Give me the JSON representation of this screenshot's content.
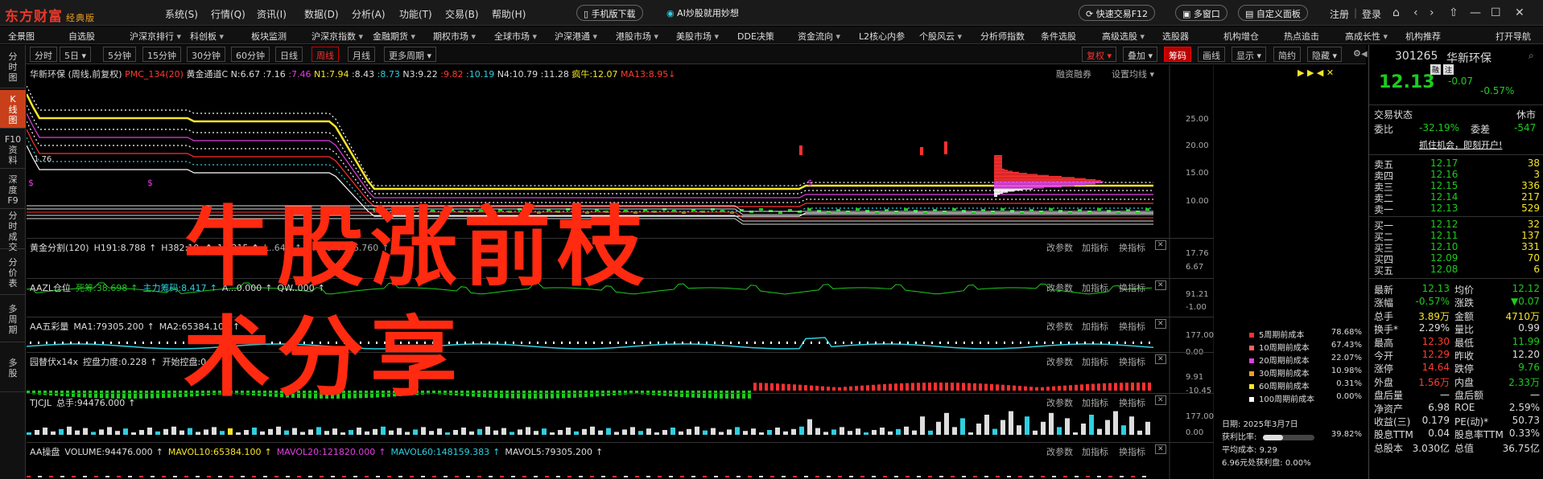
{
  "app": {
    "logo": "东方财富",
    "logo_tag": "经典版"
  },
  "menu": [
    "系统(S)",
    "行情(Q)",
    "资讯(I)",
    "数据(D)",
    "分析(A)",
    "功能(T)",
    "交易(B)",
    "帮助(H)"
  ],
  "top_pills": {
    "mobile": "手机版下载",
    "ai": "AI炒股就用妙想",
    "fast_trade": "快速交易F12",
    "multi": "多窗口",
    "custom": "自定义面板"
  },
  "auth": {
    "register": "注册",
    "login": "登录"
  },
  "tabbar": [
    "全景图",
    "自选股",
    "沪深京排行",
    "科创板",
    "板块监测",
    "沪深京指数",
    "金融期货",
    "期权市场",
    "全球市场",
    "沪深港通",
    "港股市场",
    "美股市场",
    "DDE决策",
    "资金流向",
    "L2核心内参",
    "个股风云",
    "分析师指数",
    "条件选股",
    "高级选股",
    "选股器",
    "机构增仓",
    "热点追击",
    "高成长性",
    "机构推荐",
    "打开导航"
  ],
  "periods": [
    "分时",
    "5日",
    "5分钟",
    "15分钟",
    "30分钟",
    "60分钟",
    "日线",
    "周线",
    "月线",
    "更多周期"
  ],
  "periodbar_right": [
    "复权",
    "叠加",
    "筹码",
    "画线",
    "显示",
    "简约",
    "隐藏"
  ],
  "left_tabs": [
    "分时图",
    "K线图",
    "F10资料",
    "深度F9",
    "分时成交",
    "分价表",
    "多周期",
    "多股"
  ],
  "main_info": {
    "name": "华新环保",
    "mode": "(周线,前复权)",
    "ind": "PMC_134(20)",
    "gold": "黄金通道C",
    "n1": "N:6.67",
    "n2": ":7.16",
    "n3": ":7.46",
    "n4": "N1:7.94",
    "n5": ":8.43",
    "n6": ":8.73",
    "n7": "N3:9.22",
    "n8": ":9.82",
    "n9": ":10.19",
    "n10": "N4:10.79",
    "n11": ":11.28",
    "crazy": "疯牛:12.07",
    "ma13": "MA13:8.95",
    "right1": "融资融券",
    "right2": "设置均线"
  },
  "main_axis": [
    "25.00",
    "20.00",
    "15.00",
    "10.00"
  ],
  "low_label": "1.76",
  "panes": [
    {
      "title": "黄金分割(120)",
      "vals": [
        "H191:8.788",
        "H382:10.",
        "12.215",
        "L..642",
        "6.670",
        "16.760"
      ],
      "axis": [
        "17.76",
        "6.67"
      ],
      "btns": [
        "改参数",
        "加指标",
        "换指标"
      ]
    },
    {
      "title": "AAZL仓位",
      "vals": [
        "死筹:38.698",
        "主力筹码:8.417",
        "A...0.000",
        "QW..000"
      ],
      "axis": [
        "91.21",
        "-1.00"
      ],
      "btns": [
        "改参数",
        "加指标",
        "换指标"
      ]
    },
    {
      "title": "AA五彩量",
      "vals": [
        "MA1:79305.200",
        "MA2:65384.100"
      ],
      "axis": [
        "177.00",
        "0.00"
      ],
      "btns": [
        "改参数",
        "加指标",
        "换指标"
      ]
    },
    {
      "title": "园替伏x14x",
      "vals": [
        "控盘力度:0.228",
        "开始控盘:0."
      ],
      "axis": [
        "9.91",
        "-10.45"
      ],
      "btns": [
        "改参数",
        "加指标",
        "换指标"
      ]
    },
    {
      "title": "TJCJL",
      "vals": [
        "总手:94476.000"
      ],
      "axis": [
        "177.00",
        "0.00"
      ],
      "btns": [
        "改参数",
        "加指标",
        "换指标"
      ]
    },
    {
      "title": "AA操盘",
      "vals": [
        "VOLUME:94476.000",
        "MAVOL10:65384.100",
        "MAVOL20:121820.000",
        "MAVOL60:148159.383",
        "MAVOL5:79305.200"
      ],
      "axis": [],
      "btns": [
        "改参数",
        "加指标",
        "换指标"
      ]
    }
  ],
  "overlay": {
    "line1": "牛股涨前枝",
    "line2": "术分享"
  },
  "chip_legend": [
    {
      "label": "5周期前成本",
      "value": "78.68%",
      "color": "#ff3030"
    },
    {
      "label": "10周期前成本",
      "value": "67.43%",
      "color": "#ff6060"
    },
    {
      "label": "20周期前成本",
      "value": "22.07%",
      "color": "#e040e0"
    },
    {
      "label": "30周期前成本",
      "value": "10.98%",
      "color": "#f0a020"
    },
    {
      "label": "60周期前成本",
      "value": "0.31%",
      "color": "#f7e52a"
    },
    {
      "label": "100周期前成本",
      "value": "0.00%",
      "color": "#ffffff"
    }
  ],
  "chip_info": {
    "date_label": "日期:",
    "date": "2025年3月7日",
    "profit_label": "获利比率:",
    "profit": "39.82%",
    "avg_label": "平均成本:",
    "avg": "9.29",
    "line4": "6.96元处获利盘: 0.00%"
  },
  "stock": {
    "code": "301265",
    "name": "华新环保",
    "price": "12.13",
    "change": "-0.07",
    "pct": "-0.57%",
    "badge1": "融",
    "badge2": "注"
  },
  "quote": {
    "status_label": "交易状态",
    "status": "休市",
    "wb_label": "委比",
    "wb": "-32.19%",
    "wc_label": "委差",
    "wc": "-547",
    "promo": "抓住机会，即刻开户!",
    "asks": [
      [
        "卖五",
        "12.17",
        "38"
      ],
      [
        "卖四",
        "12.16",
        "3"
      ],
      [
        "卖三",
        "12.15",
        "336"
      ],
      [
        "卖二",
        "12.14",
        "217"
      ],
      [
        "卖一",
        "12.13",
        "529"
      ]
    ],
    "bids": [
      [
        "买一",
        "12.12",
        "32"
      ],
      [
        "买二",
        "12.11",
        "137"
      ],
      [
        "买三",
        "12.10",
        "331"
      ],
      [
        "买四",
        "12.09",
        "70"
      ],
      [
        "买五",
        "12.08",
        "6"
      ]
    ],
    "stats": [
      [
        "最新",
        "12.13",
        "均价",
        "12.12"
      ],
      [
        "涨幅",
        "-0.57%",
        "涨跌",
        "▼0.07"
      ],
      [
        "总手",
        "3.89万",
        "金额",
        "4710万"
      ],
      [
        "换手*",
        "2.29%",
        "量比",
        "0.99"
      ],
      [
        "最高",
        "12.30",
        "最低",
        "11.99"
      ],
      [
        "今开",
        "12.29",
        "昨收",
        "12.20"
      ],
      [
        "涨停",
        "14.64",
        "跌停",
        "9.76"
      ],
      [
        "外盘",
        "1.56万",
        "内盘",
        "2.33万"
      ],
      [
        "盘后量",
        "一",
        "盘后额",
        "一"
      ],
      [
        "净资产",
        "6.98",
        "ROE",
        "2.59%"
      ],
      [
        "收益(三)",
        "0.179",
        "PE(动)*",
        "50.73"
      ],
      [
        "股息TTM",
        "0.04",
        "股息率TTM",
        "0.33%"
      ],
      [
        "总股本",
        "3.030亿",
        "总值",
        "36.75亿"
      ]
    ]
  }
}
